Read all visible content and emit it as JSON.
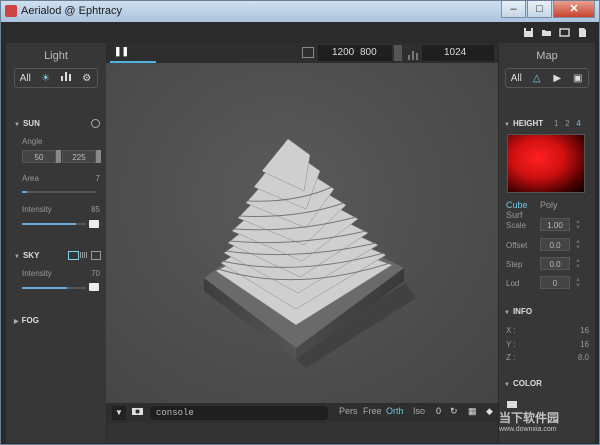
{
  "window": {
    "title": "Aerialod @ Ephtracy",
    "minimize": "–",
    "maximize": "□",
    "close": "✕"
  },
  "top_icons": {
    "save": "save-icon",
    "open": "folder-icon",
    "window": "window-icon",
    "file": "file-icon"
  },
  "left": {
    "title": "Light",
    "tabs": [
      "All"
    ],
    "sun": {
      "label": "SUN",
      "angle_label": "Angle",
      "angle_values": [
        "50",
        "225"
      ],
      "area_label": "Area",
      "area_value": "7",
      "intensity_label": "Intensity",
      "intensity_value": "85",
      "intensity_fraction": 0.85,
      "area_fraction": 0.07
    },
    "sky": {
      "label": "SKY",
      "intensity_label": "Intensity",
      "intensity_value": "70",
      "intensity_fraction": 0.7
    },
    "fog": {
      "label": "FOG"
    }
  },
  "toolbar": {
    "pause": "❚❚",
    "resolution_w": "1200",
    "resolution_h": "800",
    "samples": "1024"
  },
  "bottom": {
    "console_placeholder": "console",
    "views": [
      "Pers",
      "Free",
      "Orth",
      "Iso"
    ],
    "active_view": "Orth",
    "count": "0"
  },
  "right": {
    "title": "Map",
    "tabs": [
      "All"
    ],
    "height": {
      "label": "HEIGHT",
      "levels": [
        "1",
        "2",
        "4"
      ],
      "active_level": "4",
      "modes": [
        "Cube",
        "Poly",
        "Surf"
      ],
      "active_mode": "Cube",
      "scale_label": "Scale",
      "scale": "1.00",
      "offset_label": "Offset",
      "offset": "0.0",
      "step_label": "Step",
      "step": "0.0",
      "lod_label": "Lod",
      "lod": "0"
    },
    "info": {
      "label": "INFO",
      "x_label": "X :",
      "x": "16",
      "y_label": "Y :",
      "y": "16",
      "z_label": "Z :",
      "z": "8.0"
    },
    "color": {
      "label": "COLOR"
    }
  },
  "watermark": {
    "line1": "当下软件园",
    "line2": "www.downxia.com"
  },
  "colors": {
    "accent": "#6ec6e0",
    "slider": "#6ea6d8",
    "heightmap": "#e01010"
  }
}
